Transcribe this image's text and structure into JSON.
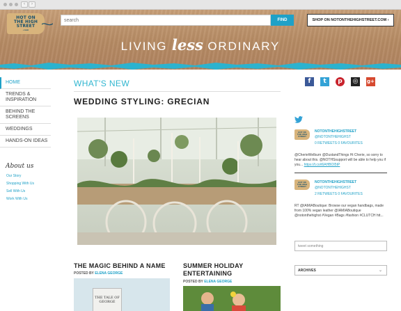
{
  "header": {
    "logo_lines": [
      "HOT ON",
      "THE HIGH",
      "STREET",
      ".com"
    ],
    "search_placeholder": "search",
    "find_label": "FIND",
    "shop_label": "SHOP ON NOTONTHEHIGHSTREET.COM ›",
    "tagline_left": "LIVING",
    "tagline_mid": "less",
    "tagline_right": "ORDINARY"
  },
  "sidebar": {
    "items": [
      {
        "label": "HOME",
        "active": true
      },
      {
        "label": "TRENDS & INSPIRATION"
      },
      {
        "label": "BEHIND THE SCREENS"
      },
      {
        "label": "WEDDINGS"
      },
      {
        "label": "HANDS-ON IDEAS"
      }
    ],
    "about_title": "About us",
    "about_links": [
      "Our Story",
      "Shopping With Us",
      "Sell With Us",
      "Work With Us"
    ]
  },
  "main": {
    "section_title": "WHAT'S NEW",
    "post_title": "WEDDING STYLING: GRECIAN",
    "cards": [
      {
        "title": "THE MAGIC BEHIND A NAME",
        "byline_prefix": "POSTED BY",
        "author": "ELENA GEORGE",
        "thumb_text": "THE TALE OF GEORGE"
      },
      {
        "title_line1": "SUMMER HOLIDAY",
        "title_line2": "ENTERTAINING",
        "byline_prefix": "POSTED BY",
        "author": "ELENA GEORGE"
      }
    ]
  },
  "social_icons": [
    {
      "name": "facebook-icon",
      "glyph": "f",
      "color": "#3b5998"
    },
    {
      "name": "twitter-icon",
      "glyph": "t",
      "color": "#33a2d6"
    },
    {
      "name": "pinterest-icon",
      "glyph": "p",
      "color": "#c8232c"
    },
    {
      "name": "instagram-icon",
      "glyph": "◎",
      "color": "#222222"
    },
    {
      "name": "googleplus-icon",
      "glyph": "g+",
      "color": "#d6492f"
    }
  ],
  "tweets": [
    {
      "name": "NOTONTHEHIGHSTREET",
      "handle": "@NOTONTHEHIGHST",
      "stats": "0 RETWEETS 0 FAVOURITES",
      "text": "@CherieWelburn @DustandThings Hi Cherie, so sorry to hear about this. @NOTHSsupport will be able to help you if you...",
      "link": "https://t.co/t6AHBOI5tP"
    },
    {
      "name": "NOTONTHEHIGHSTREET",
      "handle": "@NOTONTHEHIGHST",
      "stats": "2 RETWEETS 0 FAVOURITES",
      "text": "RT @IAMIABoutique: Browse our vegan handbags, made from 100% vegan leather @IAMIABoutique @notonthehighst #Vegan #Bags #fashion #CLUTCH htt..."
    }
  ],
  "tweet_placeholder": "tweet something",
  "archives_label": "ARCHIVES",
  "colors": {
    "accent": "#1fa1c7",
    "hero": "#b58a63",
    "brush": "#2bb3cf"
  }
}
